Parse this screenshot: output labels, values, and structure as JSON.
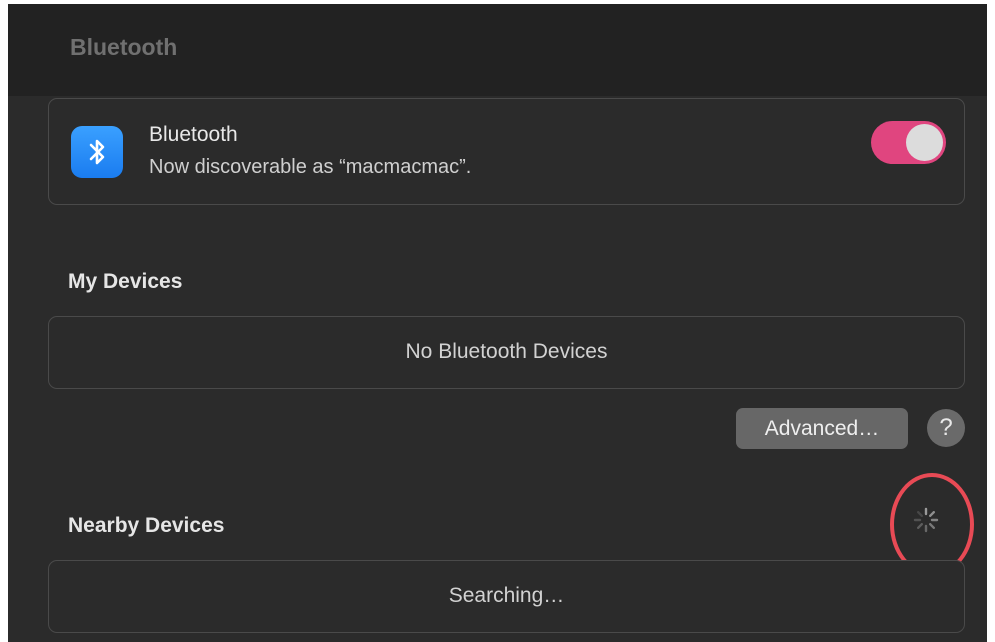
{
  "window": {
    "title": "Bluetooth"
  },
  "bluetooth": {
    "title": "Bluetooth",
    "subtitle": "Now discoverable as “macmacmac”.",
    "enabled": true,
    "icon": "bluetooth-icon",
    "toggle_color": "#e0457f"
  },
  "my_devices": {
    "heading": "My Devices",
    "empty_text": "No Bluetooth Devices"
  },
  "actions": {
    "advanced_label": "Advanced…",
    "help_label": "?"
  },
  "nearby_devices": {
    "heading": "Nearby Devices",
    "status_text": "Searching…",
    "loading_icon": "spinner-icon"
  },
  "annotation": {
    "highlight_color": "#e84a55"
  }
}
